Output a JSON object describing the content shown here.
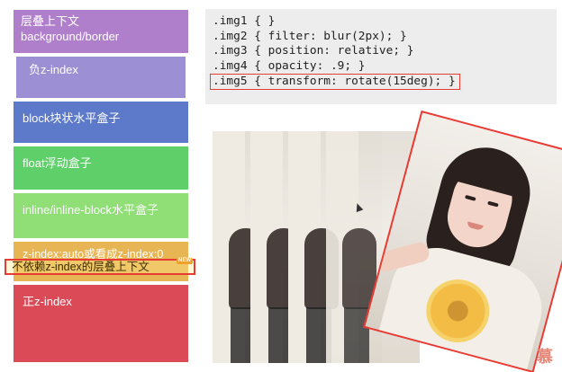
{
  "layers": {
    "background": "层叠上下文\nbackground/border",
    "negative_z": "负z-index",
    "block": "block块状水平盒子",
    "float": "float浮动盒子",
    "inline": "inline/inline-block水平盒子",
    "auto": "z-index:auto或看成z-index:0",
    "callout": "不依赖z-index的层叠上下文",
    "callout_badge": "NEW",
    "positive_z": "正z-index"
  },
  "code": {
    "lines": [
      ".img1 { }",
      ".img2 { filter: blur(2px); }",
      ".img3 { position: relative; }",
      ".img4 { opacity: .9; }",
      ".img5 { transform: rotate(15deg); }"
    ],
    "highlighted_line_index": 4
  },
  "photos": {
    "count": 5,
    "rotation_deg": 15
  },
  "colors": {
    "background_layer": "#b07fcc",
    "negative_layer": "#9d8fd4",
    "block_layer": "#5d79c9",
    "float_layer": "#5fcf6a",
    "inline_layer": "#8fde76",
    "auto_layer": "#e8b554",
    "positive_layer": "#da4a57",
    "highlight_border": "#e83b33"
  },
  "watermark": {
    "icon": "brand-logo-icon",
    "text": "慕"
  }
}
